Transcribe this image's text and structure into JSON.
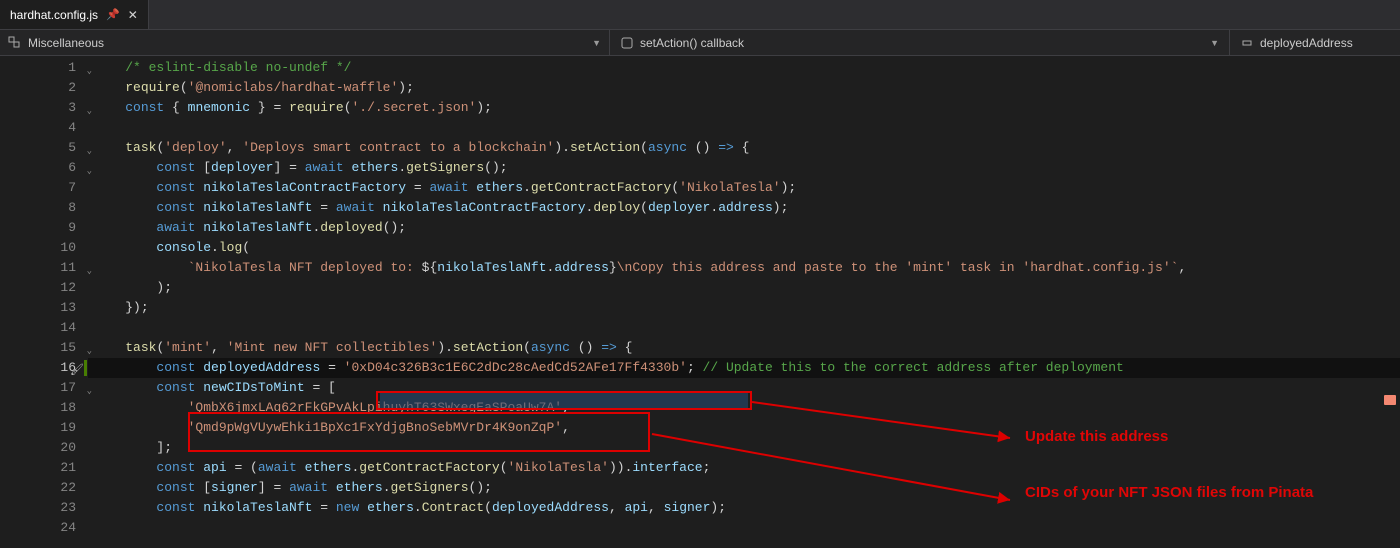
{
  "tab": {
    "filename": "hardhat.config.js"
  },
  "navbar": {
    "scope": "Miscellaneous",
    "context": "setAction() callback",
    "symbol": "deployedAddress"
  },
  "annotations": {
    "label1": "Update this address",
    "label2": "CIDs of your NFT JSON files from Pinata"
  },
  "lines": [
    {
      "n": 1,
      "fold": "v",
      "tokens": [
        [
          "c-comment",
          "/* eslint-disable no-undef */"
        ]
      ]
    },
    {
      "n": 2,
      "tokens": [
        [
          "c-fn",
          "require"
        ],
        [
          "c-pn",
          "("
        ],
        [
          "c-str",
          "'@nomiclabs/hardhat-waffle'"
        ],
        [
          "c-pn",
          ");"
        ]
      ]
    },
    {
      "n": 3,
      "fold": "v",
      "tokens": [
        [
          "c-key",
          "const "
        ],
        [
          "c-pn",
          "{ "
        ],
        [
          "c-id",
          "mnemonic"
        ],
        [
          "c-pn",
          " } = "
        ],
        [
          "c-fn",
          "require"
        ],
        [
          "c-pn",
          "("
        ],
        [
          "c-str",
          "'./.secret.json'"
        ],
        [
          "c-pn",
          ");"
        ]
      ]
    },
    {
      "n": 4,
      "tokens": []
    },
    {
      "n": 5,
      "fold": "v",
      "tokens": [
        [
          "c-fn",
          "task"
        ],
        [
          "c-pn",
          "("
        ],
        [
          "c-str",
          "'deploy'"
        ],
        [
          "c-pn",
          ", "
        ],
        [
          "c-str",
          "'Deploys smart contract to a blockchain'"
        ],
        [
          "c-pn",
          ")."
        ],
        [
          "c-fn",
          "setAction"
        ],
        [
          "c-pn",
          "("
        ],
        [
          "c-key",
          "async"
        ],
        [
          "c-pn",
          " () "
        ],
        [
          "c-key",
          "=>"
        ],
        [
          "c-pn",
          " {"
        ]
      ]
    },
    {
      "n": 6,
      "fold": "v",
      "indent": 1,
      "tokens": [
        [
          "c-key",
          "const "
        ],
        [
          "c-pn",
          "["
        ],
        [
          "c-id",
          "deployer"
        ],
        [
          "c-pn",
          "] = "
        ],
        [
          "c-key",
          "await "
        ],
        [
          "c-id",
          "ethers"
        ],
        [
          "c-pn",
          "."
        ],
        [
          "c-fn",
          "getSigners"
        ],
        [
          "c-pn",
          "();"
        ]
      ]
    },
    {
      "n": 7,
      "indent": 1,
      "tokens": [
        [
          "c-key",
          "const "
        ],
        [
          "c-id",
          "nikolaTeslaContractFactory"
        ],
        [
          "c-pn",
          " = "
        ],
        [
          "c-key",
          "await "
        ],
        [
          "c-id",
          "ethers"
        ],
        [
          "c-pn",
          "."
        ],
        [
          "c-fn",
          "getContractFactory"
        ],
        [
          "c-pn",
          "("
        ],
        [
          "c-str",
          "'NikolaTesla'"
        ],
        [
          "c-pn",
          ");"
        ]
      ]
    },
    {
      "n": 8,
      "indent": 1,
      "tokens": [
        [
          "c-key",
          "const "
        ],
        [
          "c-id",
          "nikolaTeslaNft"
        ],
        [
          "c-pn",
          " = "
        ],
        [
          "c-key",
          "await "
        ],
        [
          "c-id",
          "nikolaTeslaContractFactory"
        ],
        [
          "c-pn",
          "."
        ],
        [
          "c-fn",
          "deploy"
        ],
        [
          "c-pn",
          "("
        ],
        [
          "c-id",
          "deployer"
        ],
        [
          "c-pn",
          "."
        ],
        [
          "c-id",
          "address"
        ],
        [
          "c-pn",
          ");"
        ]
      ]
    },
    {
      "n": 9,
      "indent": 1,
      "tokens": [
        [
          "c-key",
          "await "
        ],
        [
          "c-id",
          "nikolaTeslaNft"
        ],
        [
          "c-pn",
          "."
        ],
        [
          "c-fn",
          "deployed"
        ],
        [
          "c-pn",
          "();"
        ]
      ]
    },
    {
      "n": 10,
      "indent": 1,
      "tokens": [
        [
          "c-id",
          "console"
        ],
        [
          "c-pn",
          "."
        ],
        [
          "c-fn",
          "log"
        ],
        [
          "c-pn",
          "("
        ]
      ]
    },
    {
      "n": 11,
      "fold": "v",
      "indent": 2,
      "tokens": [
        [
          "c-tpl",
          "`NikolaTesla NFT deployed to: "
        ],
        [
          "c-pn",
          "${"
        ],
        [
          "c-id",
          "nikolaTeslaNft"
        ],
        [
          "c-pn",
          "."
        ],
        [
          "c-id",
          "address"
        ],
        [
          "c-pn",
          "}"
        ],
        [
          "c-tpl",
          "\\nCopy this address and paste to the 'mint' task in 'hardhat.config.js'`"
        ],
        [
          "c-pn",
          ","
        ]
      ]
    },
    {
      "n": 12,
      "indent": 1,
      "tokens": [
        [
          "c-pn",
          ");"
        ]
      ]
    },
    {
      "n": 13,
      "tokens": [
        [
          "c-pn",
          "});"
        ]
      ]
    },
    {
      "n": 14,
      "tokens": []
    },
    {
      "n": 15,
      "fold": "v",
      "tokens": [
        [
          "c-fn",
          "task"
        ],
        [
          "c-pn",
          "("
        ],
        [
          "c-str",
          "'mint'"
        ],
        [
          "c-pn",
          ", "
        ],
        [
          "c-str",
          "'Mint new NFT collectibles'"
        ],
        [
          "c-pn",
          ")."
        ],
        [
          "c-fn",
          "setAction"
        ],
        [
          "c-pn",
          "("
        ],
        [
          "c-key",
          "async"
        ],
        [
          "c-pn",
          " () "
        ],
        [
          "c-key",
          "=>"
        ],
        [
          "c-pn",
          " {"
        ]
      ]
    },
    {
      "n": 16,
      "current": true,
      "indent": 1,
      "tokens": [
        [
          "c-key",
          "const "
        ],
        [
          "c-id",
          "deployedAddress"
        ],
        [
          "c-pn",
          " = "
        ],
        [
          "c-str",
          "'0xD04c326B3c1E6C2dDc28cAedCd52AFe17Ff4330b'"
        ],
        [
          "c-pn",
          "; "
        ],
        [
          "c-comment",
          "// Update this to the correct address after deployment"
        ]
      ]
    },
    {
      "n": 17,
      "fold": "v",
      "indent": 1,
      "tokens": [
        [
          "c-key",
          "const "
        ],
        [
          "c-id",
          "newCIDsToMint"
        ],
        [
          "c-pn",
          " = ["
        ]
      ]
    },
    {
      "n": 18,
      "indent": 2,
      "tokens": [
        [
          "c-str",
          "'QmbX6jmxLAq62rFkGPvAkLpihuyhT63SWxegEaSPoaUw7A'"
        ],
        [
          "c-pn",
          ","
        ]
      ]
    },
    {
      "n": 19,
      "indent": 2,
      "tokens": [
        [
          "c-str",
          "'Qmd9pWgVUywEhki1BpXc1FxYdjgBnoSebMVrDr4K9onZqP'"
        ],
        [
          "c-pn",
          ","
        ]
      ]
    },
    {
      "n": 20,
      "indent": 1,
      "tokens": [
        [
          "c-pn",
          "];"
        ]
      ]
    },
    {
      "n": 21,
      "indent": 1,
      "tokens": [
        [
          "c-key",
          "const "
        ],
        [
          "c-id",
          "api"
        ],
        [
          "c-pn",
          " = ("
        ],
        [
          "c-key",
          "await "
        ],
        [
          "c-id",
          "ethers"
        ],
        [
          "c-pn",
          "."
        ],
        [
          "c-fn",
          "getContractFactory"
        ],
        [
          "c-pn",
          "("
        ],
        [
          "c-str",
          "'NikolaTesla'"
        ],
        [
          "c-pn",
          "))."
        ],
        [
          "c-id",
          "interface"
        ],
        [
          "c-pn",
          ";"
        ]
      ]
    },
    {
      "n": 22,
      "indent": 1,
      "tokens": [
        [
          "c-key",
          "const "
        ],
        [
          "c-pn",
          "["
        ],
        [
          "c-id",
          "signer"
        ],
        [
          "c-pn",
          "] = "
        ],
        [
          "c-key",
          "await "
        ],
        [
          "c-id",
          "ethers"
        ],
        [
          "c-pn",
          "."
        ],
        [
          "c-fn",
          "getSigners"
        ],
        [
          "c-pn",
          "();"
        ]
      ]
    },
    {
      "n": 23,
      "indent": 1,
      "tokens": [
        [
          "c-key",
          "const "
        ],
        [
          "c-id",
          "nikolaTeslaNft"
        ],
        [
          "c-pn",
          " = "
        ],
        [
          "c-key",
          "new "
        ],
        [
          "c-id",
          "ethers"
        ],
        [
          "c-pn",
          "."
        ],
        [
          "c-fn",
          "Contract"
        ],
        [
          "c-pn",
          "("
        ],
        [
          "c-id",
          "deployedAddress"
        ],
        [
          "c-pn",
          ", "
        ],
        [
          "c-id",
          "api"
        ],
        [
          "c-pn",
          ", "
        ],
        [
          "c-id",
          "signer"
        ],
        [
          "c-pn",
          ");"
        ]
      ]
    },
    {
      "n": 24,
      "tokens": []
    }
  ]
}
